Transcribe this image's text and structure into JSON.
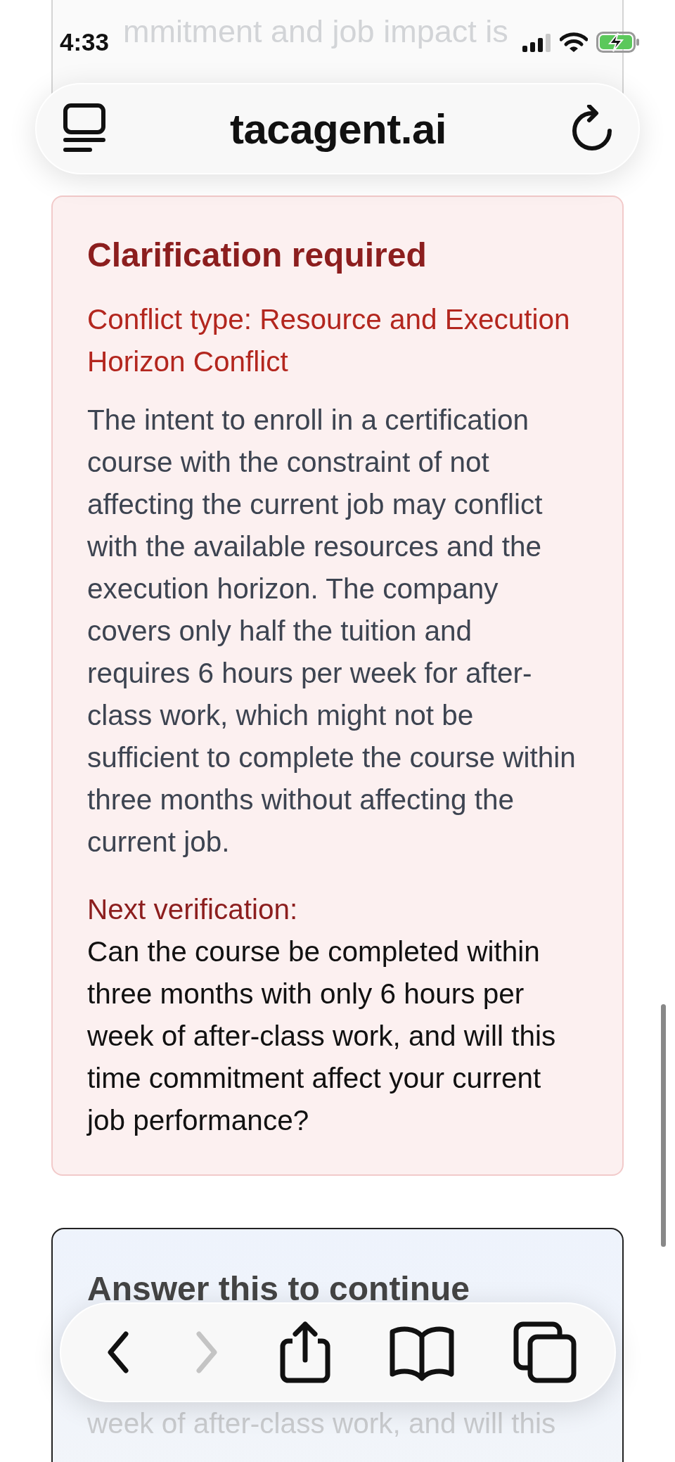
{
  "status_bar": {
    "time": "4:33"
  },
  "address_bar": {
    "url": "tacagent.ai"
  },
  "previous_card": {
    "lines": [
      "mmitment and job impact is"
    ]
  },
  "clarification": {
    "title": "Clarification required",
    "conflict_type": "Conflict type: Resource and Execution Horizon Conflict",
    "description": "The intent to enroll in a certification course with the constraint of not affecting the current job may conflict with the available resources and the execution horizon. The company covers only half the tuition and requires 6 hours per week for after-class work, which might not be sufficient to complete the course within three months without affecting the current job.",
    "next_label": "Next verification:",
    "question": "Can the course be completed within three months with only 6 hours per week of after-class work, and will this time commitment affect your current job performance?"
  },
  "answer_card": {
    "title": "Answer this to continue",
    "question_lines": [
      "week of after-class work, and will this"
    ]
  },
  "toolbar": {
    "buttons": [
      {
        "kind": "back",
        "disabled": false
      },
      {
        "kind": "forward",
        "disabled": true
      },
      {
        "kind": "share",
        "disabled": false
      },
      {
        "kind": "bookmarks",
        "disabled": false
      },
      {
        "kind": "tabs",
        "disabled": false
      }
    ]
  }
}
